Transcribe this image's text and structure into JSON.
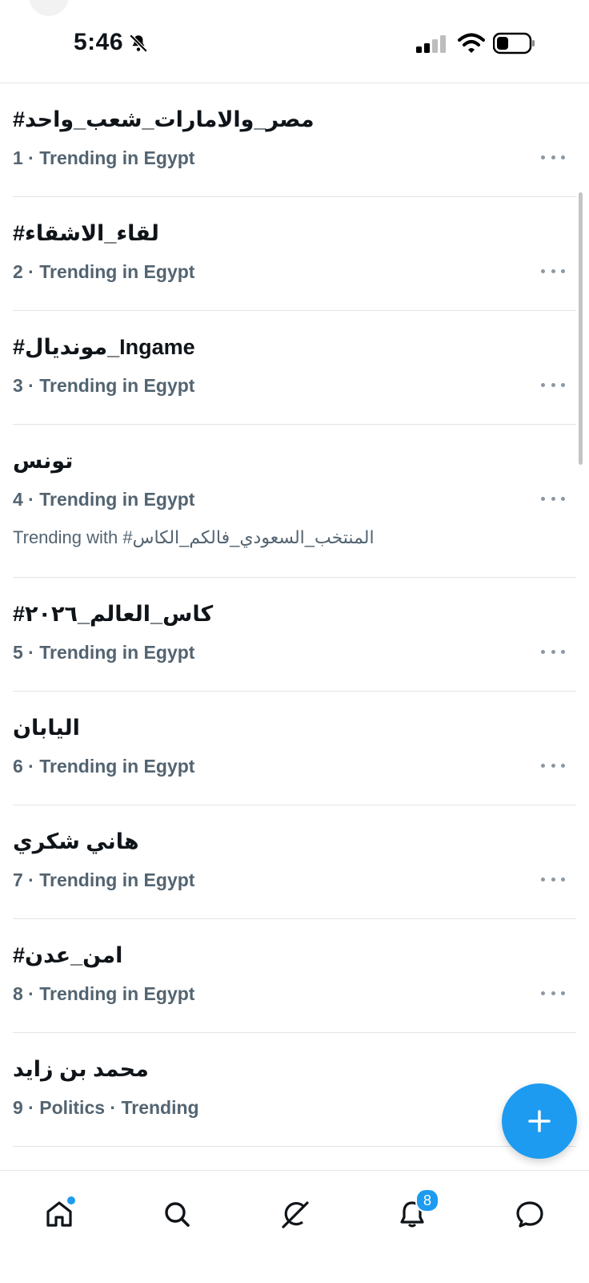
{
  "status_bar": {
    "time": "5:46"
  },
  "trends": [
    {
      "topic": "#مصر_والامارات_شعب_واحد",
      "meta": "1 · Trending in Egypt"
    },
    {
      "topic": "#لقاء_الاشقاء",
      "meta": "2 · Trending in Egypt"
    },
    {
      "topic": "#مونديال_Ingame",
      "meta": "3 · Trending in Egypt"
    },
    {
      "topic": "تونس",
      "meta": "4 · Trending in Egypt",
      "trending_with": "Trending with #المنتخب_السعودي_فالكم_الكاس"
    },
    {
      "topic": "#كاس_العالم_٢٠٢٦",
      "meta": "5 · Trending in Egypt"
    },
    {
      "topic": "اليابان",
      "meta": "6 · Trending in Egypt"
    },
    {
      "topic": "هاني شكري",
      "meta": "7 · Trending in Egypt"
    },
    {
      "topic": "#امن_عدن",
      "meta": "8 · Trending in Egypt"
    },
    {
      "topic": "محمد بن زايد",
      "meta": "9 · Politics · Trending"
    }
  ],
  "bottom_nav": {
    "items": [
      {
        "icon": "home-icon"
      },
      {
        "icon": "search-icon"
      },
      {
        "icon": "grok-icon"
      },
      {
        "icon": "bell-icon",
        "badge": "8"
      },
      {
        "icon": "messages-icon"
      }
    ]
  },
  "colors": {
    "accent": "#1d9bf0",
    "primary_text": "#0f1419",
    "secondary_text": "#536471"
  }
}
